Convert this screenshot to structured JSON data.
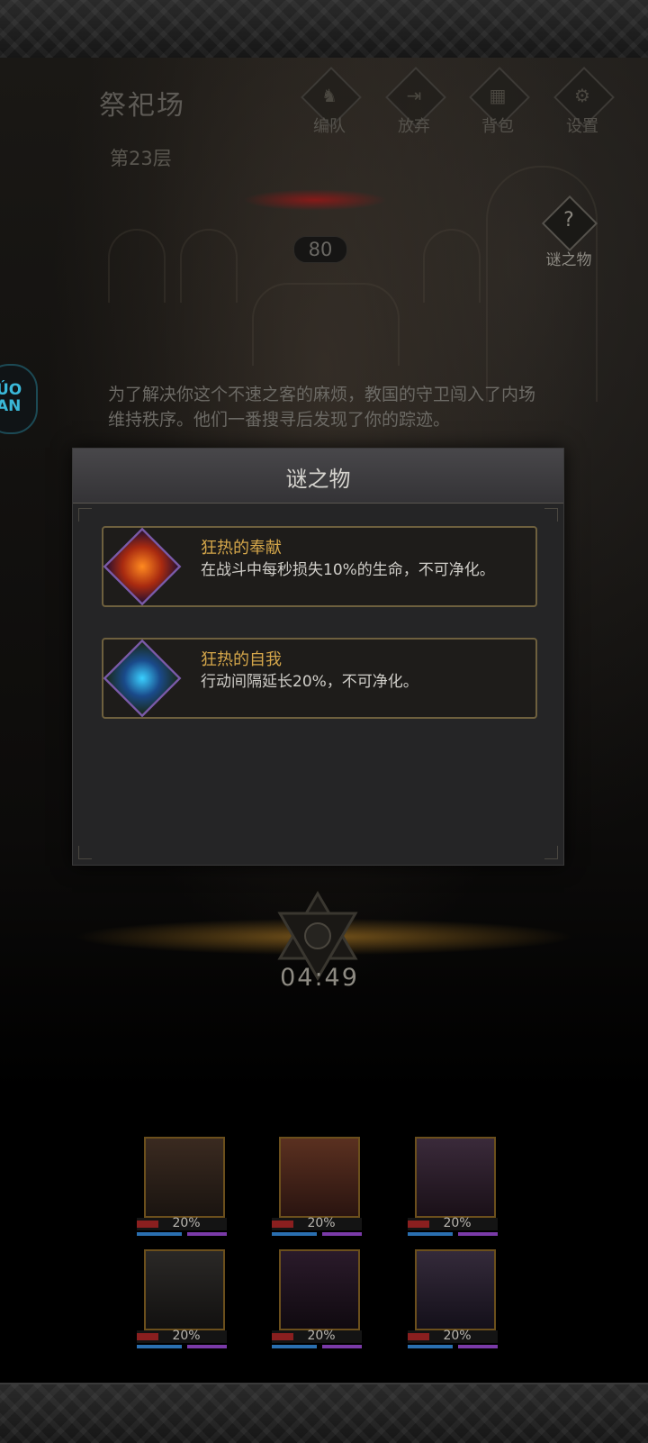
{
  "header": {
    "location_title": "祭祀场",
    "floor_label": "第23层",
    "buttons": [
      {
        "label": "编队",
        "icon": "formation-icon"
      },
      {
        "label": "放弃",
        "icon": "abandon-icon"
      },
      {
        "label": "背包",
        "icon": "backpack-icon"
      },
      {
        "label": "设置",
        "icon": "settings-icon"
      }
    ],
    "side_button": {
      "label": "谜之物",
      "icon": "mystery-question-icon"
    }
  },
  "counter": "80",
  "float_badge": "ÚO\nAN",
  "story_text": "为了解决你这个不速之客的麻烦，教国的守卫闯入了内场维持秩序。他们一番搜寻后发现了你的踪迹。",
  "modal": {
    "title": "谜之物",
    "items": [
      {
        "name": "狂热的奉献",
        "description": "在战斗中每秒损失10%的生命，不可净化。",
        "icon": "burning-figure-icon"
      },
      {
        "name": "狂热的自我",
        "description": "行动间隔延长20%，不可净化。",
        "icon": "lightning-figure-icon"
      }
    ]
  },
  "timer": "04:49",
  "party": [
    {
      "hp_percent": "20%",
      "portrait": "character-portrait-1"
    },
    {
      "hp_percent": "20%",
      "portrait": "character-portrait-2"
    },
    {
      "hp_percent": "20%",
      "portrait": "character-portrait-3"
    },
    {
      "hp_percent": "20%",
      "portrait": "character-portrait-4"
    },
    {
      "hp_percent": "20%",
      "portrait": "character-portrait-5"
    },
    {
      "hp_percent": "20%",
      "portrait": "character-portrait-6"
    }
  ],
  "colors": {
    "accent_gold": "#d4a64a",
    "item_border": "#6e603e",
    "icon_frame_purple": "#7a5aa8"
  }
}
